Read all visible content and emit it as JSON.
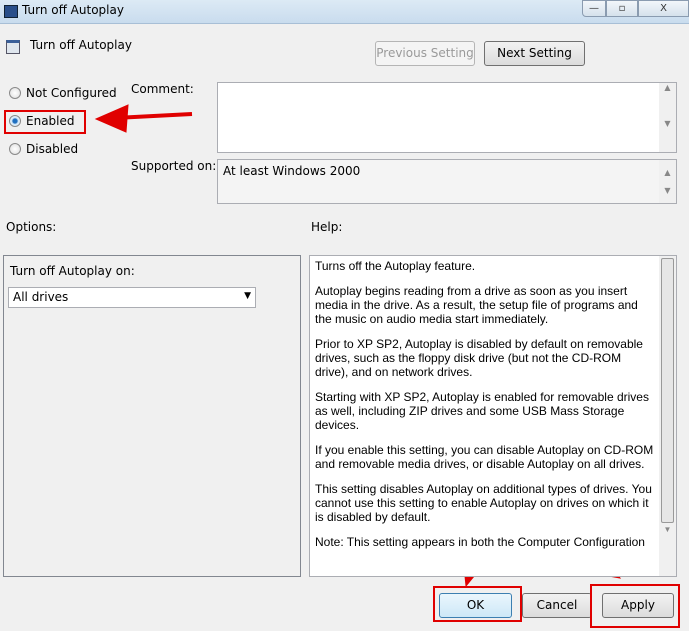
{
  "window": {
    "title": "Turn off Autoplay",
    "minimize": "—",
    "maximize": "▫",
    "close": "X"
  },
  "header": {
    "title": "Turn off Autoplay",
    "prev_label": "Previous Setting",
    "next_label": "Next Setting"
  },
  "state": {
    "options": [
      "Not Configured",
      "Enabled",
      "Disabled"
    ],
    "selected": "Enabled"
  },
  "comment": {
    "label": "Comment:",
    "value": ""
  },
  "supported": {
    "label": "Supported on:",
    "value": "At least Windows 2000"
  },
  "options_panel": {
    "label": "Options:",
    "field_label": "Turn off Autoplay on:",
    "dropdown_value": "All drives"
  },
  "help": {
    "label": "Help:",
    "paragraphs": [
      "Turns off the Autoplay feature.",
      "Autoplay begins reading from a drive as soon as you insert media in the drive. As a result, the setup file of programs and the music on audio media start immediately.",
      "Prior to XP SP2, Autoplay is disabled by default on removable drives, such as the floppy disk drive (but not the CD-ROM drive), and on network drives.",
      "Starting with XP SP2, Autoplay is enabled for removable drives as well, including ZIP drives and some USB Mass Storage devices.",
      "If you enable this setting, you can disable Autoplay on CD-ROM and removable media drives, or disable Autoplay on all drives.",
      "This setting disables Autoplay on additional types of drives. You cannot use this setting to enable Autoplay on drives on which it is disabled by default.",
      "Note: This setting appears in both the Computer Configuration"
    ]
  },
  "footer": {
    "ok": "OK",
    "cancel": "Cancel",
    "apply": "Apply"
  },
  "annotation_color": "#e00000"
}
